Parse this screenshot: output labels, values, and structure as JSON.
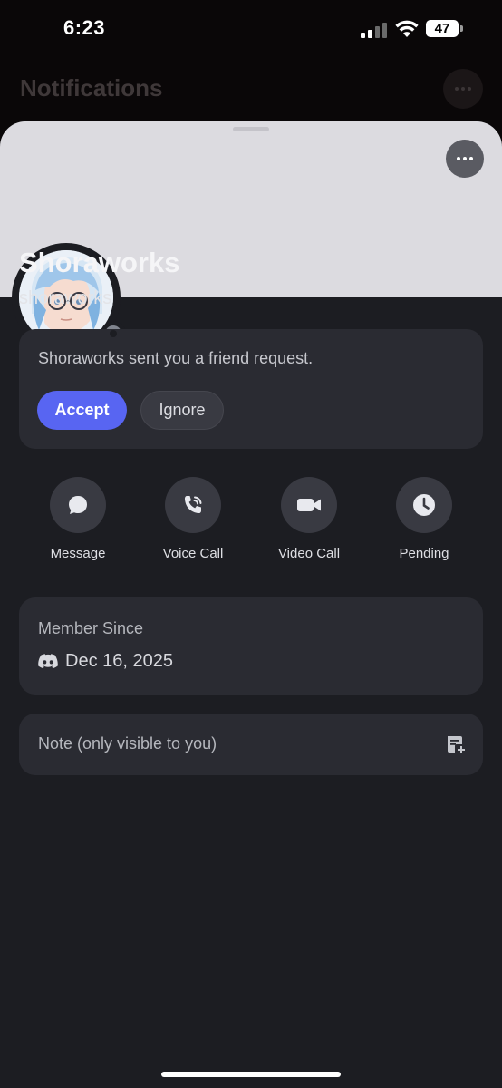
{
  "status_bar": {
    "time": "6:23",
    "battery": "47"
  },
  "background": {
    "title": "Notifications"
  },
  "profile": {
    "display_name": "Shoraworks",
    "username": "shoraworks",
    "status": "offline"
  },
  "friend_request": {
    "message": "Shoraworks sent you a friend request.",
    "accept_label": "Accept",
    "ignore_label": "Ignore"
  },
  "actions": [
    {
      "label": "Message",
      "icon": "chat-bubble-icon"
    },
    {
      "label": "Voice Call",
      "icon": "phone-icon"
    },
    {
      "label": "Video Call",
      "icon": "video-camera-icon"
    },
    {
      "label": "Pending",
      "icon": "clock-icon"
    }
  ],
  "member_since": {
    "title": "Member Since",
    "date": "Dec 16, 2025"
  },
  "note": {
    "placeholder": "Note (only visible to you)"
  },
  "colors": {
    "accent": "#5865f2",
    "sheet_bg": "#1c1d22",
    "card_bg": "#2a2b32",
    "banner": "#dcdbe0"
  }
}
